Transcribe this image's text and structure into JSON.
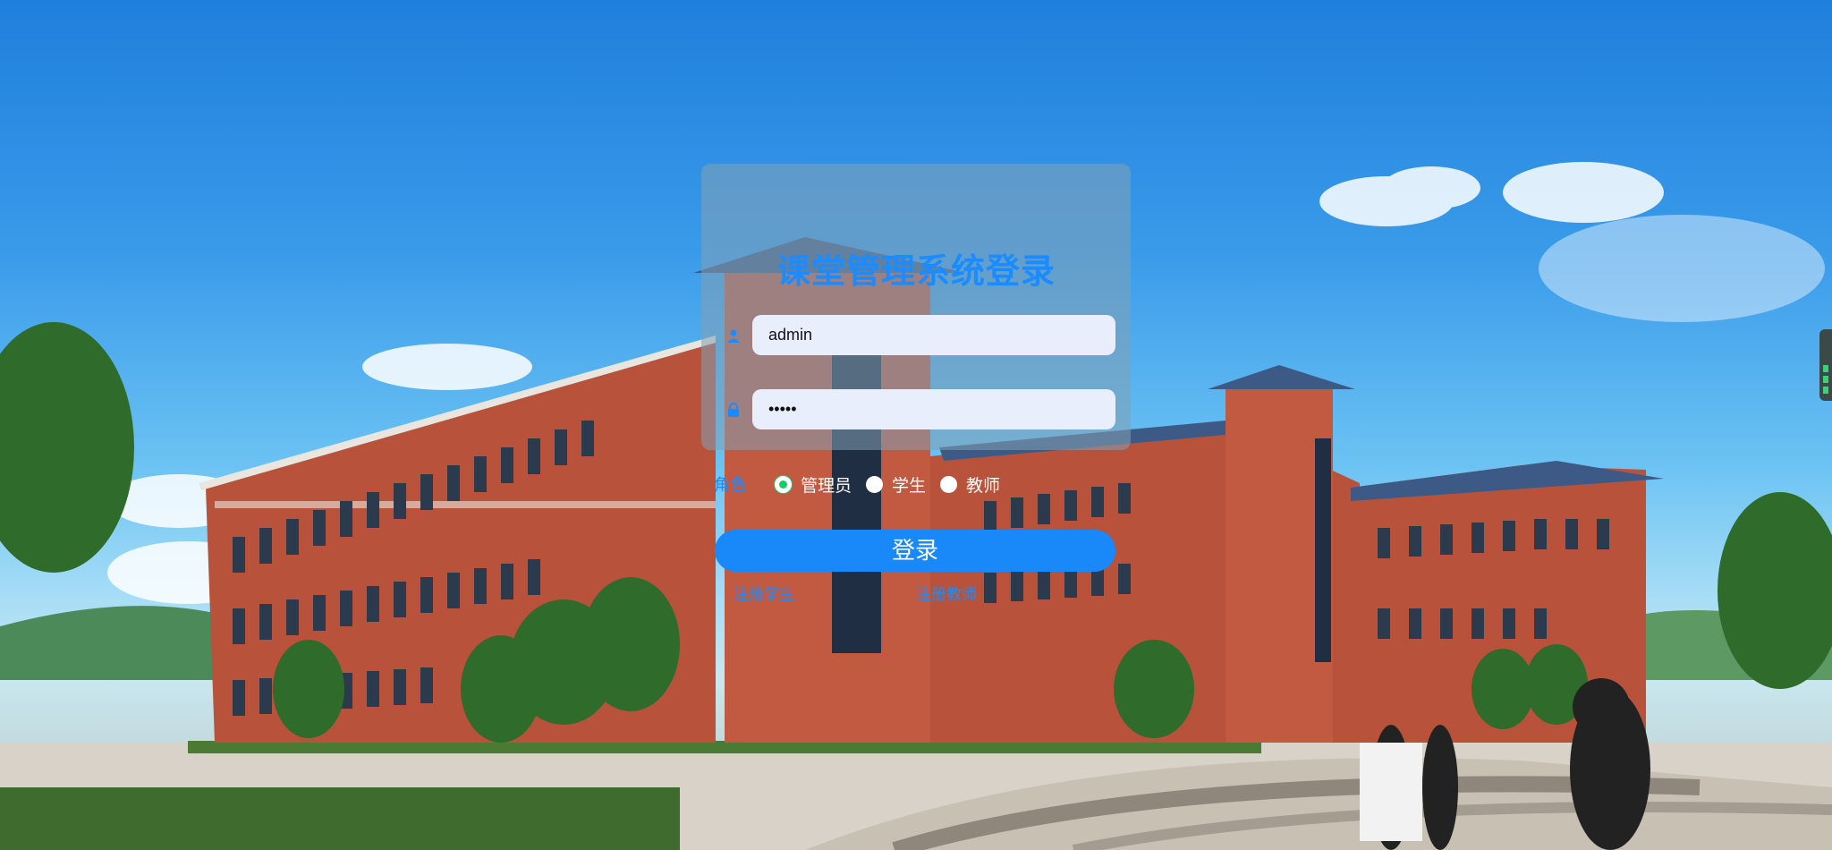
{
  "login": {
    "title": "课堂管理系统登录",
    "username_value": "admin",
    "password_value": "admin",
    "role_label": "角色",
    "roles": [
      {
        "label": "管理员",
        "checked": true
      },
      {
        "label": "学生",
        "checked": false
      },
      {
        "label": "教师",
        "checked": false
      }
    ],
    "login_button": "登录",
    "register_student": "注册学生",
    "register_teacher": "注册教师"
  },
  "icons": {
    "username": "user-icon",
    "password": "lock-icon"
  },
  "colors": {
    "accent": "#1989fa",
    "title": "#1b8cff",
    "radio_checked": "#13ce66",
    "panel": "rgba(132,160,180,0.55)",
    "input_bg": "#e8eefb"
  }
}
